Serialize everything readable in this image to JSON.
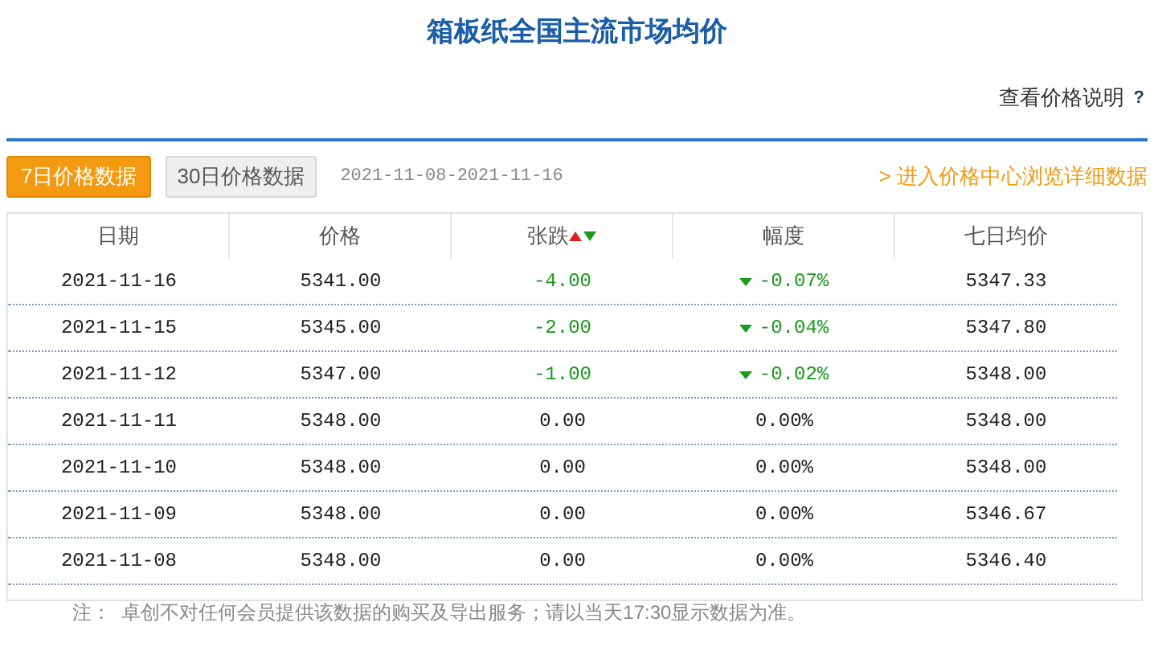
{
  "title": "箱板纸全国主流市场均价",
  "help_link": {
    "label": "查看价格说明",
    "icon": "?"
  },
  "tabs": [
    {
      "label": "7日价格数据",
      "selected": true
    },
    {
      "label": "30日价格数据",
      "selected": false
    }
  ],
  "date_range": "2021-11-08-2021-11-16",
  "detail_link": "> 进入价格中心浏览详细数据",
  "table": {
    "columns": [
      "日期",
      "价格",
      "张跌",
      "幅度",
      "七日均价"
    ],
    "rows": [
      {
        "kind": "down",
        "cells": [
          "2021-11-16",
          "5341.00",
          "-4.00",
          "-0.07%",
          "5347.33"
        ]
      },
      {
        "kind": "down",
        "cells": [
          "2021-11-15",
          "5345.00",
          "-2.00",
          "-0.04%",
          "5347.80"
        ]
      },
      {
        "kind": "down",
        "cells": [
          "2021-11-12",
          "5347.00",
          "-1.00",
          "-0.02%",
          "5348.00"
        ]
      },
      {
        "kind": "flat",
        "cells": [
          "2021-11-11",
          "5348.00",
          "0.00",
          "0.00%",
          "5348.00"
        ]
      },
      {
        "kind": "flat",
        "cells": [
          "2021-11-10",
          "5348.00",
          "0.00",
          "0.00%",
          "5348.00"
        ]
      },
      {
        "kind": "flat",
        "cells": [
          "2021-11-09",
          "5348.00",
          "0.00",
          "0.00%",
          "5346.67"
        ]
      },
      {
        "kind": "flat",
        "cells": [
          "2021-11-08",
          "5348.00",
          "0.00",
          "0.00%",
          "5346.40"
        ]
      }
    ]
  },
  "note": "注：  卓创不对任何会员提供该数据的购买及导出服务；请以当天17:30显示数据为准。"
}
